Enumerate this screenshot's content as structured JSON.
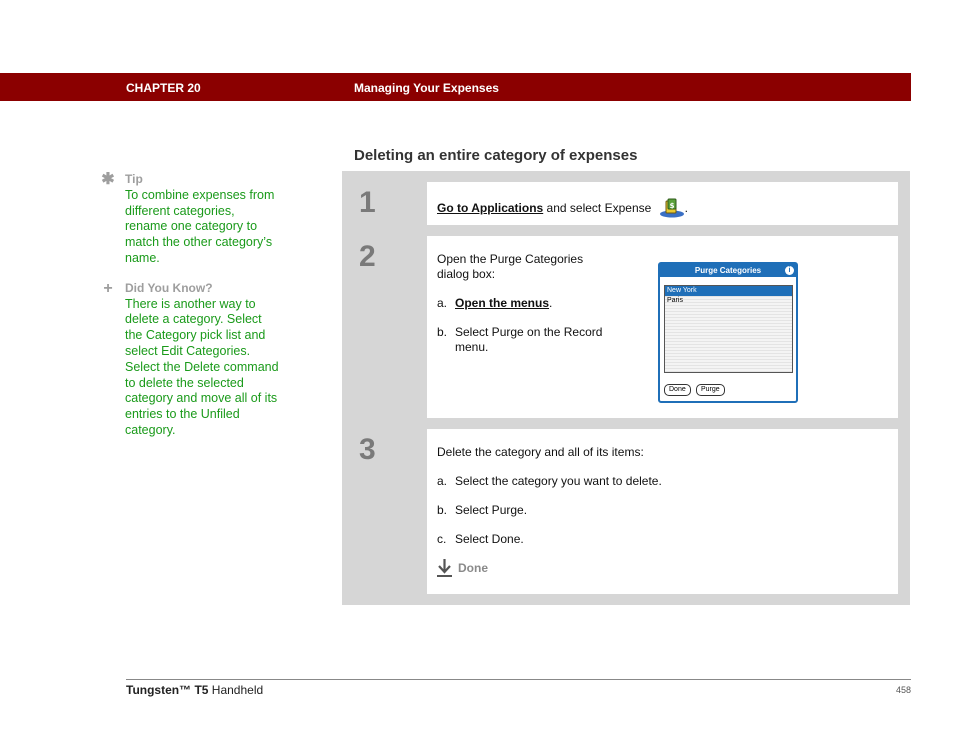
{
  "header": {
    "chapter": "CHAPTER 20",
    "title": "Managing Your Expenses",
    "bg_color": "#8b0000"
  },
  "section_title": "Deleting an entire category of expenses",
  "sidebar": {
    "tip": {
      "icon": "asterisk-icon",
      "heading": "Tip",
      "text": "To combine expenses from different categories, rename one category to match the other category’s name."
    },
    "did_you_know": {
      "icon": "plus-icon",
      "heading": "Did You Know?",
      "text": "There is another way to delete a category. Select the Category pick list and select Edit Categories. Select the Delete command to delete the selected category and move all of its entries to the Unfiled category."
    },
    "text_color": "#1a9a1a"
  },
  "steps": [
    {
      "number": "1",
      "link": "Go to Applications",
      "text": " and select Expense",
      "icon": "expense-app-icon",
      "end": "."
    },
    {
      "number": "2",
      "intro": "Open the Purge Categories dialog box:",
      "a_prefix": "a.",
      "a_link": "Open the menus",
      "a_end": ".",
      "b_prefix": "b.",
      "b_text": "Select Purge on the Record menu.",
      "dialog": {
        "title": "Purge Categories",
        "info": "i",
        "items": [
          "New York",
          "Paris"
        ],
        "selected": "New York",
        "done_button": "Done",
        "purge_button": "Purge"
      }
    },
    {
      "number": "3",
      "intro": "Delete the category and all of its items:",
      "a_prefix": "a.",
      "a_text": "Select the category you want to delete.",
      "b_prefix": "b.",
      "b_text": "Select Purge.",
      "c_prefix": "c.",
      "c_text": "Select Done.",
      "done_label": "Done",
      "done_icon": "arrow-down-icon"
    }
  ],
  "footer": {
    "brand": "Tungsten™ T5",
    "product": " Handheld",
    "page": "458"
  }
}
